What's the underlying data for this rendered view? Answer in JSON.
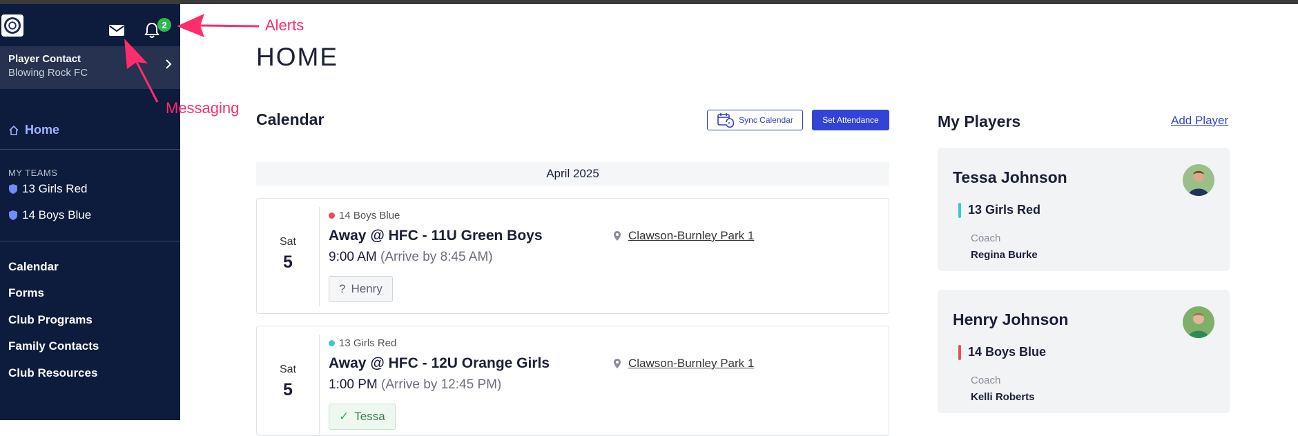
{
  "sidebar": {
    "alerts_count": "2",
    "contact_role": "Player Contact",
    "contact_club": "Blowing Rock FC",
    "home_label": "Home",
    "teams_header": "MY TEAMS",
    "teams": [
      {
        "name": "13 Girls Red"
      },
      {
        "name": "14 Boys Blue"
      }
    ],
    "menu": [
      {
        "label": "Calendar"
      },
      {
        "label": "Forms"
      },
      {
        "label": "Club Programs"
      },
      {
        "label": "Family Contacts"
      },
      {
        "label": "Club Resources"
      }
    ]
  },
  "annotations": {
    "alerts": "Alerts",
    "messaging": "Messaging"
  },
  "main": {
    "page_title": "HOME",
    "calendar": {
      "title": "Calendar",
      "sync_label": "Sync Calendar",
      "attendance_label": "Set Attendance",
      "month": "April 2025",
      "events": [
        {
          "day": "Sat",
          "date": "5",
          "team": "14 Boys Blue",
          "team_color": "#e74c5a",
          "title": "Away @ HFC - 11U Green Boys",
          "time": "9:00 AM",
          "arrive": "(Arrive by 8:45 AM)",
          "location": "Clawson-Burnley Park 1",
          "player": "Henry",
          "player_status": "?"
        },
        {
          "day": "Sat",
          "date": "5",
          "team": "13 Girls Red",
          "team_color": "#3cc6d2",
          "title": "Away @ HFC - 12U Orange Girls",
          "time": "1:00 PM",
          "arrive": "(Arrive by 12:45 PM)",
          "location": "Clawson-Burnley Park 1",
          "player": "Tessa",
          "player_status": "✓"
        }
      ]
    },
    "players": {
      "title": "My Players",
      "add_label": "Add Player",
      "cards": [
        {
          "name": "Tessa Johnson",
          "team": "13 Girls Red",
          "team_color": "#3cc6d2",
          "coach_label": "Coach",
          "coach": "Regina Burke"
        },
        {
          "name": "Henry Johnson",
          "team": "14 Boys Blue",
          "team_color": "#e74c5a",
          "coach_label": "Coach",
          "coach": "Kelli Roberts"
        }
      ]
    }
  },
  "colors": {
    "sidebar_bg": "#0d1b3d",
    "accent": "#3144d6",
    "annotation": "#ff2d6b",
    "badge": "#2fb84f"
  },
  "icons": [
    "mail-icon",
    "bell-icon",
    "chevron-right-icon",
    "home-icon",
    "shield-icon",
    "calendar-sync-icon",
    "map-pin-icon",
    "question-icon",
    "check-icon"
  ]
}
